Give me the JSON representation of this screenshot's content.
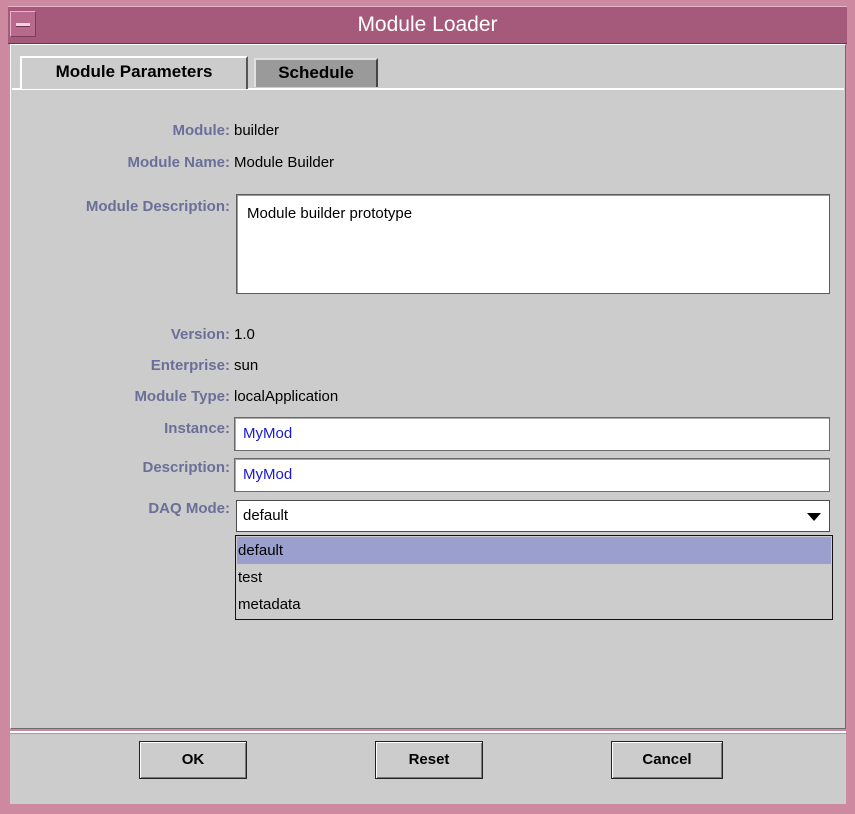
{
  "window": {
    "title": "Module Loader"
  },
  "tabs": [
    {
      "label": "Module Parameters",
      "active": true
    },
    {
      "label": "Schedule",
      "active": false
    }
  ],
  "fields": {
    "module": {
      "label": "Module:",
      "value": "builder"
    },
    "module_name": {
      "label": "Module Name:",
      "value": "Module Builder"
    },
    "module_description": {
      "label": "Module Description:",
      "value": "Module builder prototype"
    },
    "version": {
      "label": "Version:",
      "value": "1.0"
    },
    "enterprise": {
      "label": "Enterprise:",
      "value": "sun"
    },
    "module_type": {
      "label": "Module Type:",
      "value": "localApplication"
    },
    "instance": {
      "label": "Instance:",
      "value": "MyMod"
    },
    "description": {
      "label": "Description:",
      "value": "MyMod"
    },
    "daq_mode": {
      "label": "DAQ Mode:",
      "selected": "default",
      "options": [
        "default",
        "test",
        "metadata"
      ]
    }
  },
  "buttons": {
    "ok": "OK",
    "reset": "Reset",
    "cancel": "Cancel"
  },
  "colors": {
    "label": "#6b6f98",
    "titlebar": "#a55a7b",
    "frame": "#cd899f",
    "selection": "#9a9fcd",
    "input_text": "#1a1ad0"
  },
  "icons": [
    "window-menu-icon",
    "dropdown-arrow-icon"
  ]
}
